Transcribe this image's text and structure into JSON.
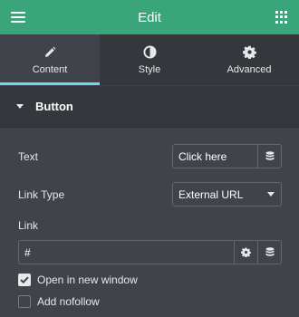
{
  "header": {
    "title": "Edit",
    "menu_icon": "hamburger-icon",
    "apps_icon": "grid-icon"
  },
  "tabs": [
    {
      "label": "Content",
      "icon": "pencil-icon",
      "active": true
    },
    {
      "label": "Style",
      "icon": "half-circle-icon",
      "active": false
    },
    {
      "label": "Advanced",
      "icon": "gear-icon",
      "active": false
    }
  ],
  "section": {
    "title": "Button"
  },
  "controls": {
    "text": {
      "label": "Text",
      "value": "Click here"
    },
    "link_type": {
      "label": "Link Type",
      "value": "External URL"
    },
    "link": {
      "label": "Link",
      "value": "#"
    },
    "open_new_window": {
      "label": "Open in new window",
      "checked": true
    },
    "add_nofollow": {
      "label": "Add nofollow",
      "checked": false
    }
  },
  "colors": {
    "header": "#3aa57b",
    "accent_tab": "#71d7f7",
    "panel": "#404349",
    "tabbar": "#34383c"
  }
}
